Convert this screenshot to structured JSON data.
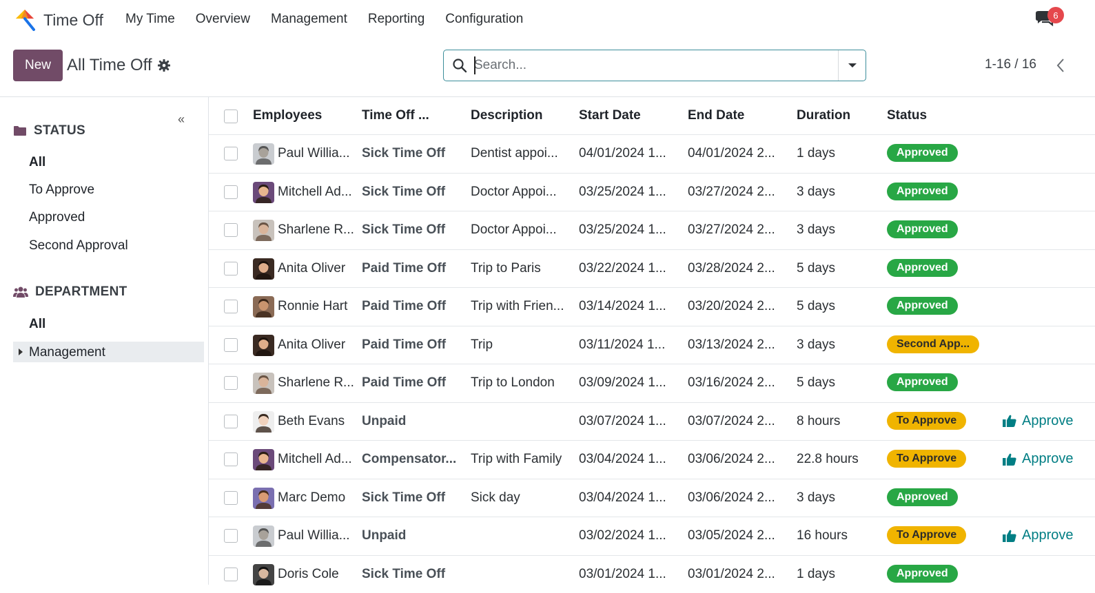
{
  "app": {
    "name": "Time Off",
    "menu": [
      "My Time",
      "Overview",
      "Management",
      "Reporting",
      "Configuration"
    ],
    "chat_count": "6"
  },
  "control": {
    "new_label": "New",
    "view_title": "All Time Off",
    "search_placeholder": "Search...",
    "pager": "1-16 / 16"
  },
  "sidebar": {
    "collapse": "«",
    "status_title": "STATUS",
    "status_items": [
      "All",
      "To Approve",
      "Approved",
      "Second Approval"
    ],
    "department_title": "DEPARTMENT",
    "department_items": [
      "All",
      "Management"
    ]
  },
  "columns": [
    "Employees",
    "Time Off ...",
    "Description",
    "Start Date",
    "End Date",
    "Duration",
    "Status"
  ],
  "approve_label": "Approve",
  "rows": [
    {
      "employee": "Paul Willia...",
      "type": "Sick Time Off",
      "description": "Dentist appoi...",
      "start": "04/01/2024 1...",
      "end": "04/01/2024 2...",
      "duration": "1 days",
      "status": "Approved",
      "status_kind": "approved",
      "avatar": "paul"
    },
    {
      "employee": "Mitchell Ad...",
      "type": "Sick Time Off",
      "description": "Doctor Appoi...",
      "start": "03/25/2024 1...",
      "end": "03/27/2024 2...",
      "duration": "3 days",
      "status": "Approved",
      "status_kind": "approved",
      "avatar": "mitchell"
    },
    {
      "employee": "Sharlene R...",
      "type": "Sick Time Off",
      "description": "Doctor Appoi...",
      "start": "03/25/2024 1...",
      "end": "03/27/2024 2...",
      "duration": "3 days",
      "status": "Approved",
      "status_kind": "approved",
      "avatar": "sharlene"
    },
    {
      "employee": "Anita Oliver",
      "type": "Paid Time Off",
      "description": "Trip to Paris",
      "start": "03/22/2024 1...",
      "end": "03/28/2024 2...",
      "duration": "5 days",
      "status": "Approved",
      "status_kind": "approved",
      "avatar": "anita"
    },
    {
      "employee": "Ronnie Hart",
      "type": "Paid Time Off",
      "description": "Trip with Frien...",
      "start": "03/14/2024 1...",
      "end": "03/20/2024 2...",
      "duration": "5 days",
      "status": "Approved",
      "status_kind": "approved",
      "avatar": "ronnie"
    },
    {
      "employee": "Anita Oliver",
      "type": "Paid Time Off",
      "description": "Trip",
      "start": "03/11/2024 1...",
      "end": "03/13/2024 2...",
      "duration": "3 days",
      "status": "Second App...",
      "status_kind": "toapprove",
      "avatar": "anita"
    },
    {
      "employee": "Sharlene R...",
      "type": "Paid Time Off",
      "description": "Trip to London",
      "start": "03/09/2024 1...",
      "end": "03/16/2024 2...",
      "duration": "5 days",
      "status": "Approved",
      "status_kind": "approved",
      "avatar": "sharlene"
    },
    {
      "employee": "Beth Evans",
      "type": "Unpaid",
      "description": "",
      "start": "03/07/2024 1...",
      "end": "03/07/2024 2...",
      "duration": "8 hours",
      "status": "To Approve",
      "status_kind": "toapprove",
      "avatar": "beth",
      "approve": true
    },
    {
      "employee": "Mitchell Ad...",
      "type": "Compensator...",
      "description": "Trip with Family",
      "start": "03/04/2024 1...",
      "end": "03/06/2024 2...",
      "duration": "22.8 hours",
      "status": "To Approve",
      "status_kind": "toapprove",
      "avatar": "mitchell",
      "approve": true
    },
    {
      "employee": "Marc Demo",
      "type": "Sick Time Off",
      "description": "Sick day",
      "start": "03/04/2024 1...",
      "end": "03/06/2024 2...",
      "duration": "3 days",
      "status": "Approved",
      "status_kind": "approved",
      "avatar": "marc"
    },
    {
      "employee": "Paul Willia...",
      "type": "Unpaid",
      "description": "",
      "start": "03/02/2024 1...",
      "end": "03/05/2024 2...",
      "duration": "16 hours",
      "status": "To Approve",
      "status_kind": "toapprove",
      "avatar": "paul",
      "approve": true
    },
    {
      "employee": "Doris Cole",
      "type": "Sick Time Off",
      "description": "",
      "start": "03/01/2024 1...",
      "end": "03/01/2024 2...",
      "duration": "1 days",
      "status": "Approved",
      "status_kind": "approved",
      "avatar": "doris"
    }
  ],
  "colors": {
    "brand": "#714b67",
    "approved": "#28a745",
    "to_approve": "#f0b400",
    "link": "#017e84"
  }
}
